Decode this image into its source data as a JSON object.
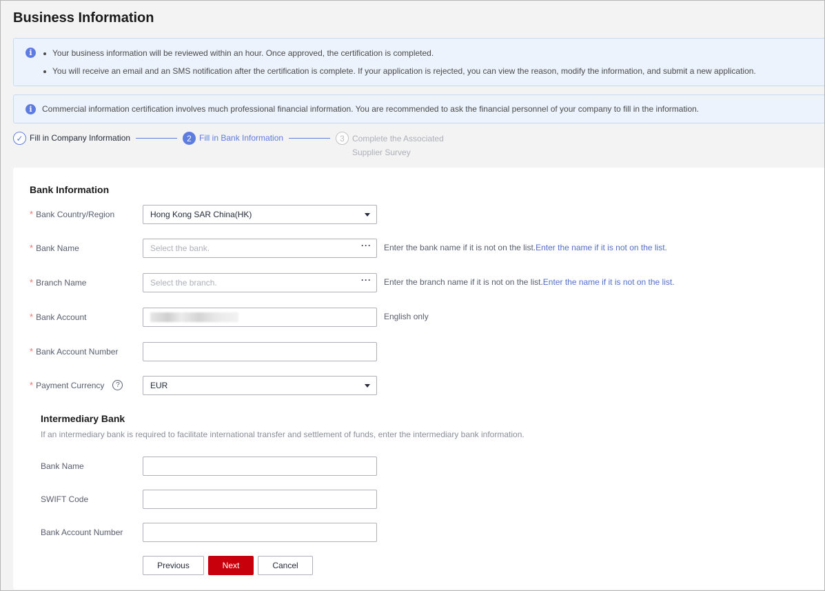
{
  "page": {
    "title": "Business Information"
  },
  "notices": {
    "review_line1": "Your business information will be reviewed within an hour. Once approved, the certification is completed.",
    "review_line2": "You will receive an email and an SMS notification after the certification is complete. If your application is rejected, you can view the reason, modify the information, and submit a new application.",
    "finance_note": "Commercial information certification involves much professional financial information. You are recommended to ask the financial personnel of your company to fill in the information.",
    "info_icon": "i"
  },
  "stepper": {
    "steps": [
      {
        "number": "✓",
        "label": "Fill in Company Information",
        "state": "done"
      },
      {
        "number": "2",
        "label": "Fill in Bank Information",
        "state": "active"
      },
      {
        "number": "3",
        "label": "Complete the Associated Supplier Survey",
        "state": "pending"
      }
    ]
  },
  "bank_info": {
    "section_title": "Bank Information",
    "required_mark": "*",
    "fields": {
      "country": {
        "label": "Bank Country/Region",
        "value": "Hong Kong SAR China(HK)"
      },
      "bank_name": {
        "label": "Bank Name",
        "placeholder": "Select the bank.",
        "hint": "Enter the bank name if it is not on the list.",
        "hint_link": "Enter the name if it is not on the list."
      },
      "branch_name": {
        "label": "Branch Name",
        "placeholder": "Select the branch.",
        "hint": "Enter the branch name if it is not on the list.",
        "hint_link": "Enter the name if it is not on the list."
      },
      "bank_account": {
        "label": "Bank Account",
        "hint": "English only"
      },
      "account_number": {
        "label": "Bank Account Number",
        "value": ""
      },
      "currency": {
        "label": "Payment Currency",
        "value": "EUR",
        "help_icon": "?"
      }
    },
    "more_icon": "···"
  },
  "intermediary": {
    "section_title": "Intermediary Bank",
    "description": "If an intermediary bank is required to facilitate international transfer and settlement of funds, enter the intermediary bank information.",
    "fields": {
      "bank_name": {
        "label": "Bank Name",
        "value": ""
      },
      "swift": {
        "label": "SWIFT Code",
        "value": ""
      },
      "account_number": {
        "label": "Bank Account Number",
        "value": ""
      }
    }
  },
  "actions": {
    "previous": "Previous",
    "next": "Next",
    "cancel": "Cancel"
  },
  "colors": {
    "accent": "#5e7ce0",
    "primary_button": "#c7000b",
    "required": "#f66f6a",
    "link": "#526ecc"
  }
}
